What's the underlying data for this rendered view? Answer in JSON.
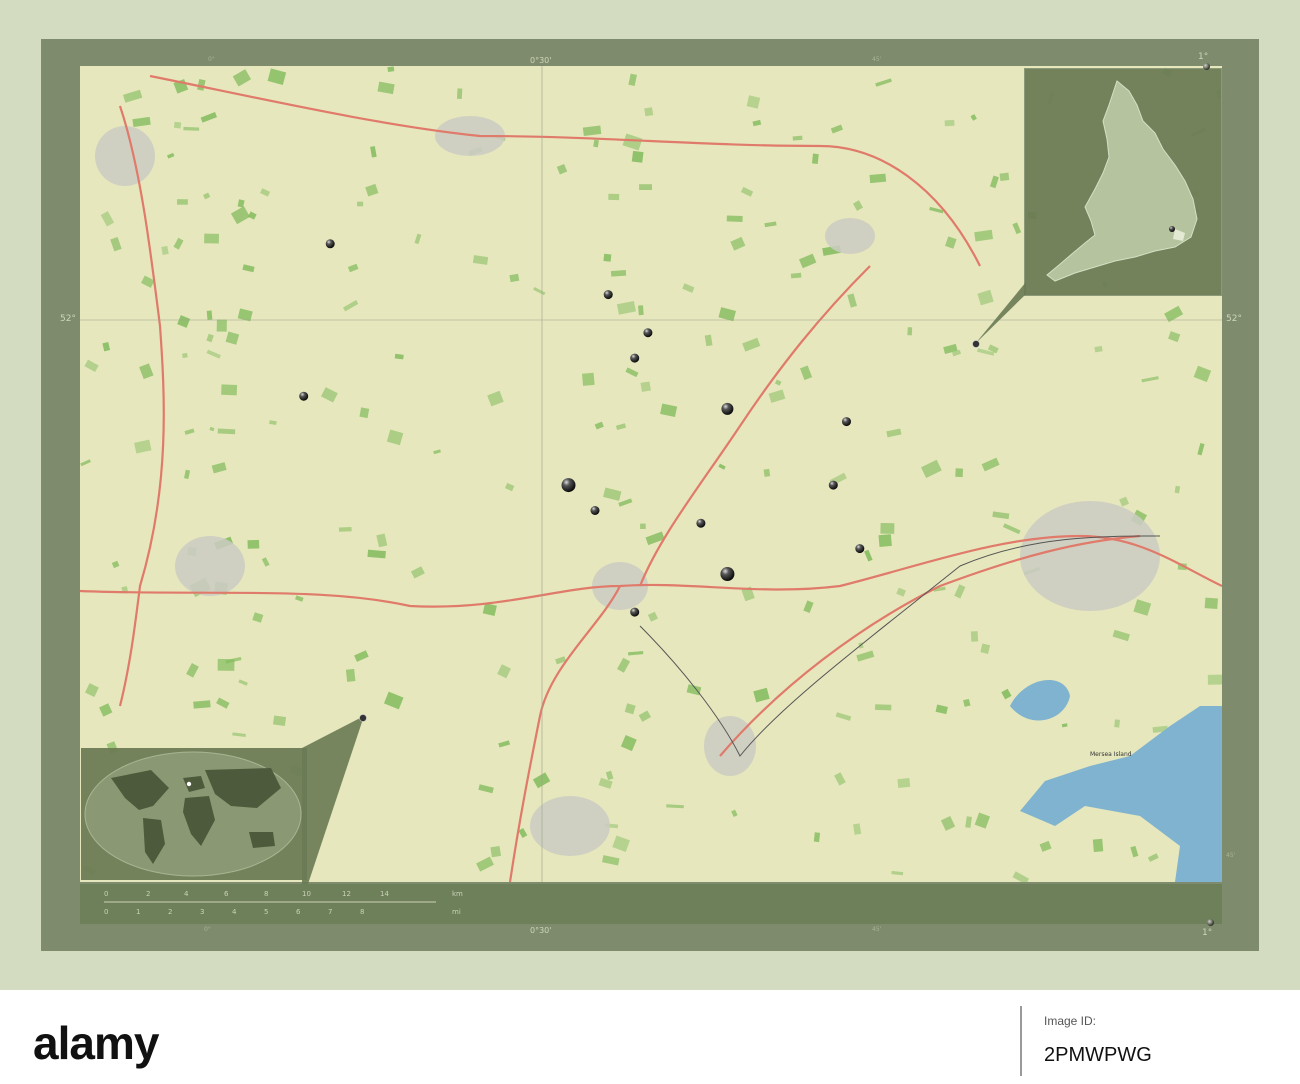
{
  "map": {
    "labels": {
      "lon_top_left": "0°",
      "lon_top_center": "0°30'",
      "lon_top_right_minor": "45'",
      "lon_top_right": "1°",
      "lon_bottom_left": "0°",
      "lon_bottom_center": "0°30'",
      "lon_bottom_right_minor": "45'",
      "lon_bottom_right": "1°",
      "lat_left": "52°",
      "lat_right": "52°",
      "lat_right_bottom": "45'"
    },
    "scalebar": {
      "km_ticks": [
        "0",
        "2",
        "4",
        "6",
        "8",
        "10",
        "12",
        "14"
      ],
      "km_unit": "km",
      "mi_ticks": [
        "0",
        "1",
        "2",
        "3",
        "4",
        "5",
        "6",
        "7",
        "8"
      ],
      "mi_unit": "mi"
    },
    "places": [
      "Mersea Island"
    ],
    "colors": {
      "land": "#e6e7bd",
      "woodland": "#7fba5a",
      "urban": "#c9c9c9",
      "water": "#7fb3cf",
      "major_road": "#e07a6a",
      "minor_road": "#f4f0c4",
      "frame": "#7e8b6c",
      "inset": "#6a7a54"
    },
    "markers": [
      {
        "name": "town-marker",
        "lon": 0.34,
        "lat": 52.06,
        "size": "small"
      },
      {
        "name": "town-marker",
        "lon": 0.55,
        "lat": 52.02,
        "size": "small"
      },
      {
        "name": "town-marker",
        "lon": 0.58,
        "lat": 51.99,
        "size": "small"
      },
      {
        "name": "town-marker",
        "lon": 0.57,
        "lat": 51.97,
        "size": "small"
      },
      {
        "name": "town-marker",
        "lon": 0.64,
        "lat": 51.93,
        "size": "medium"
      },
      {
        "name": "town-marker",
        "lon": 0.73,
        "lat": 51.92,
        "size": "small"
      },
      {
        "name": "town-marker",
        "lon": 0.32,
        "lat": 51.94,
        "size": "small"
      },
      {
        "name": "town-marker",
        "lon": 0.52,
        "lat": 51.87,
        "size": "large"
      },
      {
        "name": "town-marker",
        "lon": 0.72,
        "lat": 51.87,
        "size": "small"
      },
      {
        "name": "town-marker",
        "lon": 0.54,
        "lat": 51.85,
        "size": "small"
      },
      {
        "name": "town-marker",
        "lon": 0.62,
        "lat": 51.84,
        "size": "small"
      },
      {
        "name": "town-marker",
        "lon": 0.74,
        "lat": 51.82,
        "size": "small"
      },
      {
        "name": "town-marker",
        "lon": 0.64,
        "lat": 51.8,
        "size": "large"
      },
      {
        "name": "town-marker",
        "lon": 0.57,
        "lat": 51.77,
        "size": "small"
      }
    ]
  },
  "watermark": {
    "brand": "alamy",
    "image_id": "2PMWPWG",
    "small": "Image ID:"
  }
}
